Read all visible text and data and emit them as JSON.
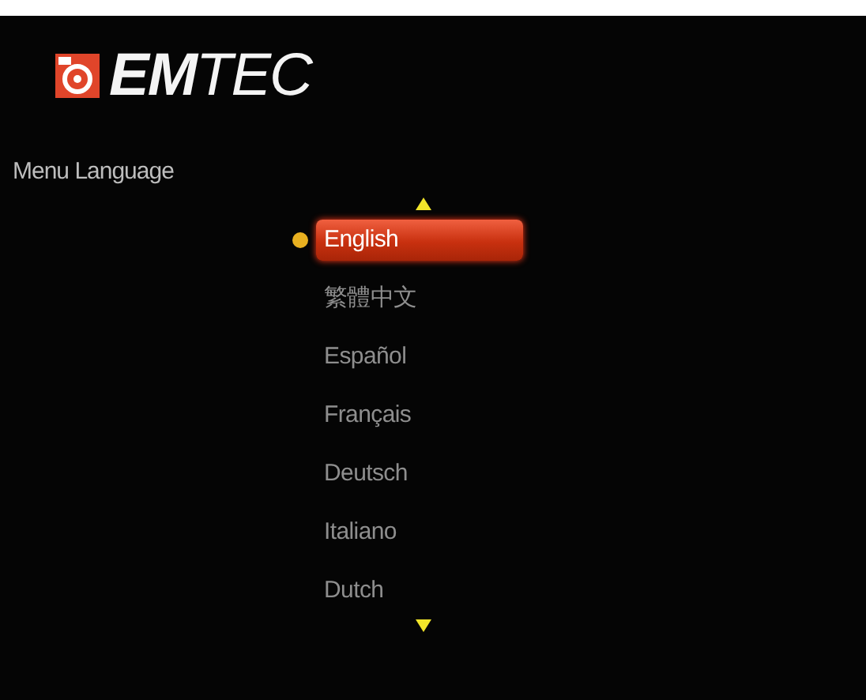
{
  "brand": {
    "name": "**EM**TEC"
  },
  "title": "Menu Language",
  "languages": [
    {
      "label": "English",
      "selected": true
    },
    {
      "label": "繁體中文",
      "selected": false
    },
    {
      "label": "Español",
      "selected": false
    },
    {
      "label": "Français",
      "selected": false
    },
    {
      "label": "Deutsch",
      "selected": false
    },
    {
      "label": "Italiano",
      "selected": false
    },
    {
      "label": "Dutch",
      "selected": false
    }
  ]
}
